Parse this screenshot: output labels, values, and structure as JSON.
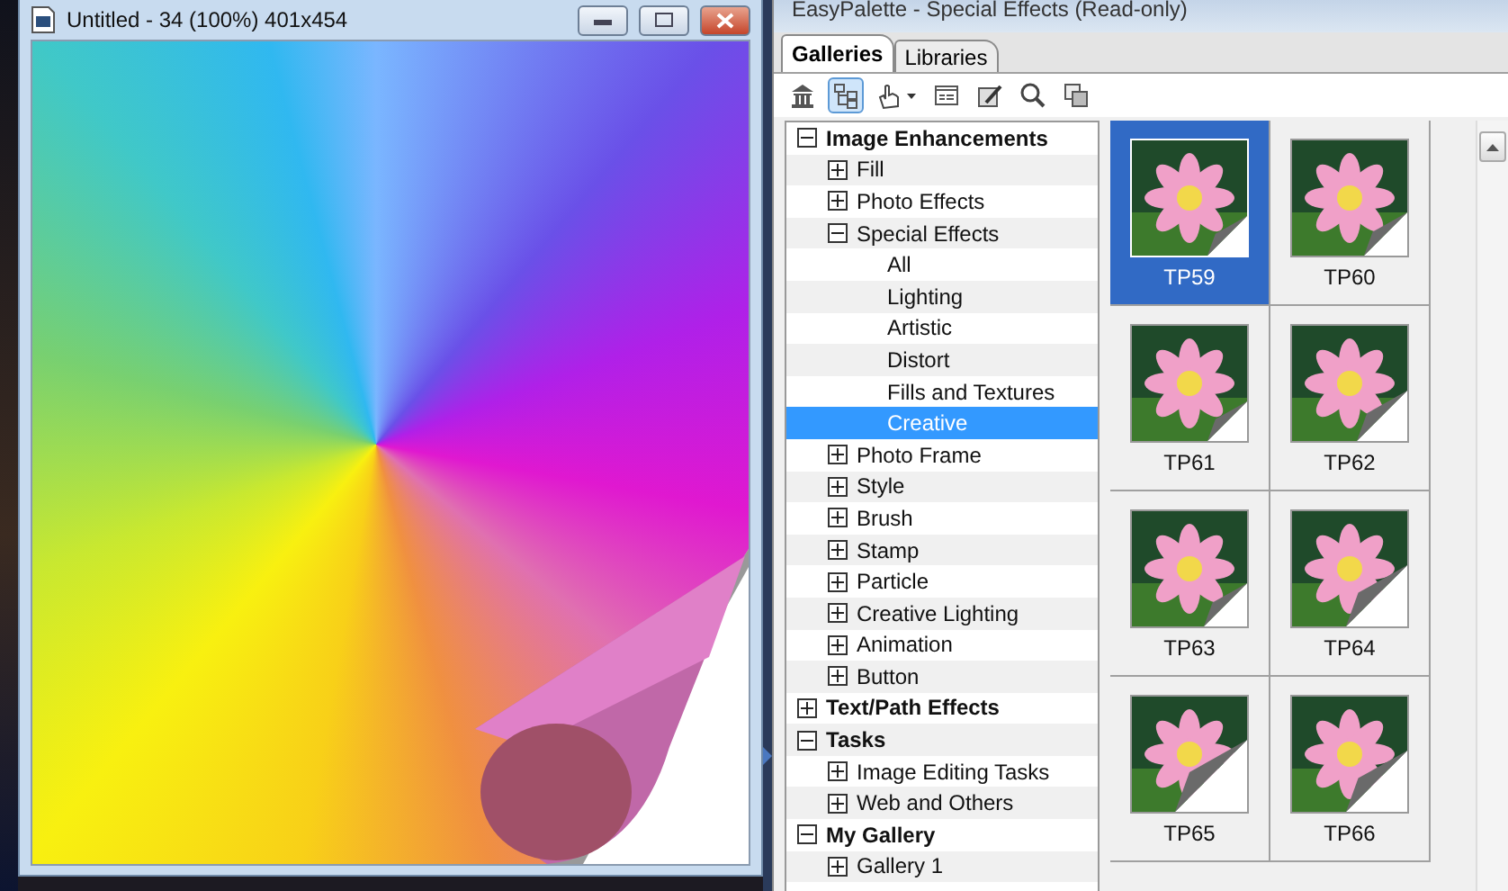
{
  "image_window": {
    "title": "Untitled - 34 (100%) 401x454"
  },
  "palette": {
    "title": "EasyPalette - Special Effects (Read-only)",
    "tabs": [
      {
        "label": "Galleries",
        "selected": true
      },
      {
        "label": "Libraries",
        "selected": false
      }
    ],
    "tools": [
      {
        "kind": "home",
        "selected": false
      },
      {
        "kind": "tree",
        "selected": true
      },
      {
        "kind": "hand",
        "selected": false
      },
      {
        "kind": "window",
        "selected": false
      },
      {
        "kind": "edit",
        "selected": false
      },
      {
        "kind": "search",
        "selected": false
      },
      {
        "kind": "layers",
        "selected": false
      }
    ],
    "tree": [
      {
        "label": "Image Enhancements",
        "kind": "branch",
        "expanded": true,
        "selected": false,
        "children": [
          {
            "label": "Fill",
            "kind": "branch",
            "expanded": false,
            "selected": false
          },
          {
            "label": "Photo Effects",
            "kind": "branch",
            "expanded": false,
            "selected": false
          },
          {
            "label": "Special Effects",
            "kind": "branch",
            "expanded": true,
            "selected": false,
            "children": [
              {
                "label": "All",
                "kind": "leaf",
                "selected": false
              },
              {
                "label": "Lighting",
                "kind": "leaf",
                "selected": false
              },
              {
                "label": "Artistic",
                "kind": "leaf",
                "selected": false
              },
              {
                "label": "Distort",
                "kind": "leaf",
                "selected": false
              },
              {
                "label": "Fills and Textures",
                "kind": "leaf",
                "selected": false
              },
              {
                "label": "Creative",
                "kind": "leaf",
                "selected": true
              }
            ]
          },
          {
            "label": "Photo Frame",
            "kind": "branch",
            "expanded": false,
            "selected": false
          },
          {
            "label": "Style",
            "kind": "branch",
            "expanded": false,
            "selected": false
          },
          {
            "label": "Brush",
            "kind": "branch",
            "expanded": false,
            "selected": false
          },
          {
            "label": "Stamp",
            "kind": "branch",
            "expanded": false,
            "selected": false
          },
          {
            "label": "Particle",
            "kind": "branch",
            "expanded": false,
            "selected": false
          },
          {
            "label": "Creative Lighting",
            "kind": "branch",
            "expanded": false,
            "selected": false
          },
          {
            "label": "Animation",
            "kind": "branch",
            "expanded": false,
            "selected": false
          },
          {
            "label": "Button",
            "kind": "branch",
            "expanded": false,
            "selected": false
          }
        ]
      },
      {
        "label": "Text/Path Effects",
        "kind": "branch",
        "expanded": false,
        "selected": false
      },
      {
        "label": "Tasks",
        "kind": "branch",
        "expanded": true,
        "selected": false,
        "children": [
          {
            "label": "Image Editing Tasks",
            "kind": "branch",
            "expanded": false,
            "selected": false
          },
          {
            "label": "Web and Others",
            "kind": "branch",
            "expanded": false,
            "selected": false
          }
        ]
      },
      {
        "label": "My Gallery",
        "kind": "branch",
        "expanded": true,
        "selected": false,
        "children": [
          {
            "label": "Gallery 1",
            "kind": "branch",
            "expanded": false,
            "selected": false
          }
        ]
      }
    ],
    "thumbnails": [
      {
        "label": "TP59",
        "selected": true
      },
      {
        "label": "TP60",
        "selected": false
      },
      {
        "label": "TP61",
        "selected": false
      },
      {
        "label": "TP62",
        "selected": false
      },
      {
        "label": "TP63",
        "selected": false
      },
      {
        "label": "TP64",
        "selected": false
      },
      {
        "label": "TP65",
        "selected": false
      },
      {
        "label": "TP66",
        "selected": false
      }
    ]
  }
}
